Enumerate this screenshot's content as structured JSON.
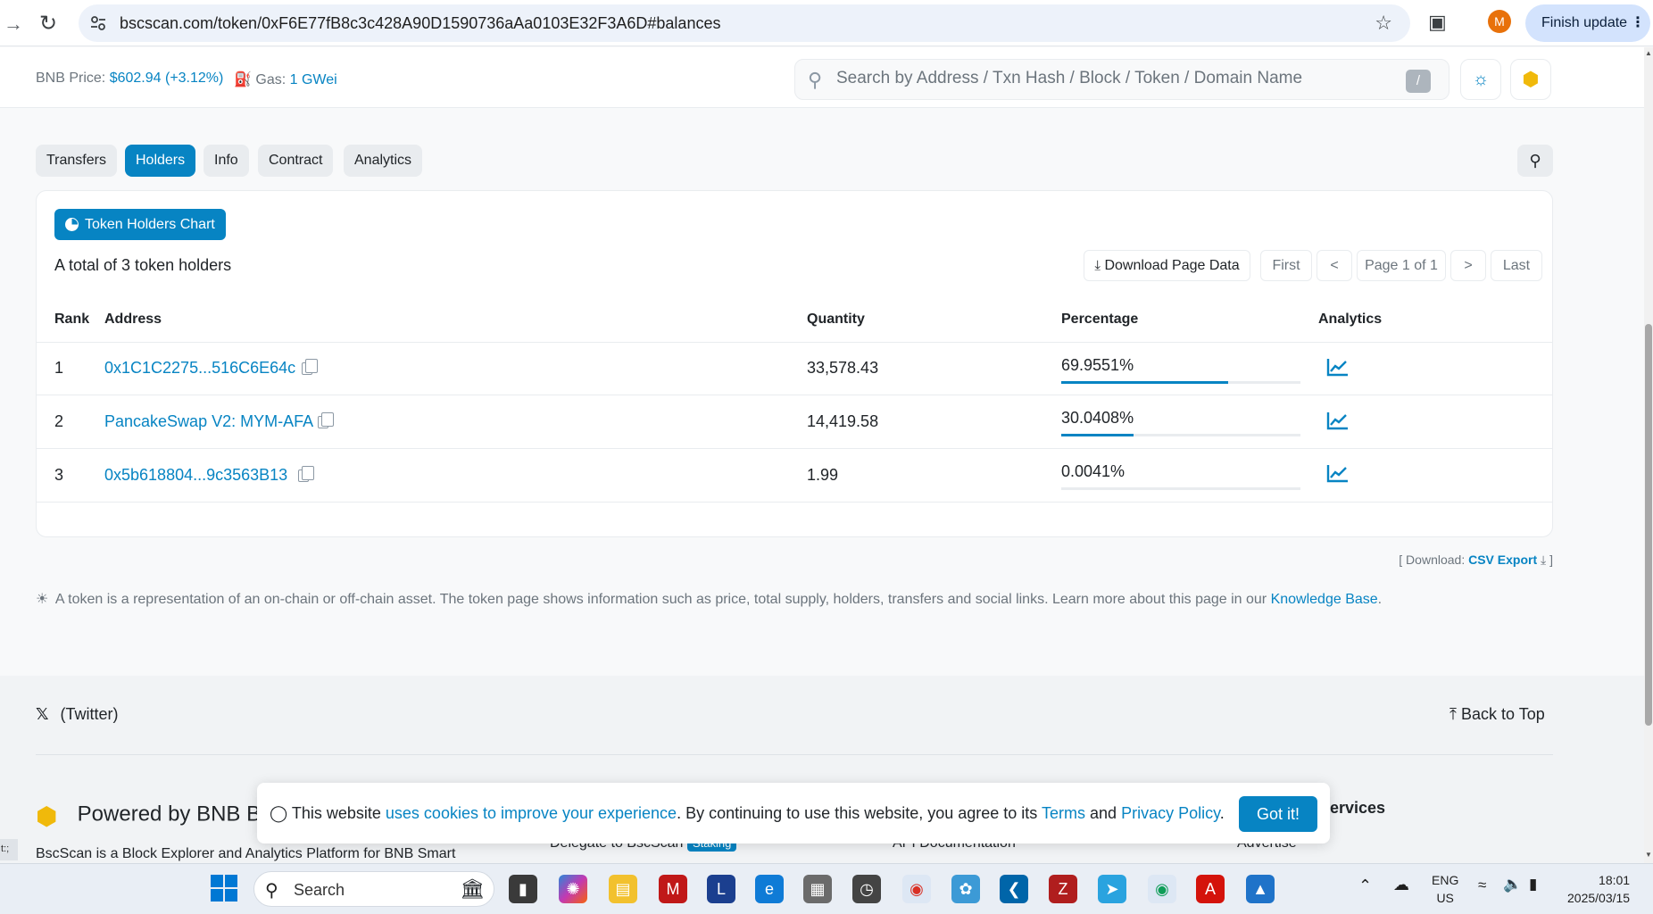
{
  "browser": {
    "url": "bscscan.com/token/0xF6E77fB8c3c428A90D1590736aAa0103E32F3A6D#balances",
    "profile_initial": "M",
    "finish_update_label": "Finish update"
  },
  "header": {
    "bnb_price_label": "BNB Price:",
    "bnb_price_value": "$602.94 (+3.12%)",
    "gas_label": "Gas:",
    "gas_value": "1 GWei",
    "search_placeholder": "Search by Address / Txn Hash / Block / Token / Domain Name",
    "search_shortcut": "/"
  },
  "tabs": [
    {
      "label": "Transfers",
      "active": false
    },
    {
      "label": "Holders",
      "active": true
    },
    {
      "label": "Info",
      "active": false
    },
    {
      "label": "Contract",
      "active": false
    },
    {
      "label": "Analytics",
      "active": false
    }
  ],
  "holders": {
    "chart_button": "Token Holders Chart",
    "total_text": "A total of 3 token holders",
    "download_page_data": "Download Page Data",
    "pager": {
      "first": "First",
      "prev": "<",
      "current": "Page 1 of 1",
      "next": ">",
      "last": "Last"
    },
    "columns": [
      "Rank",
      "Address",
      "Quantity",
      "Percentage",
      "Analytics"
    ],
    "rows": [
      {
        "rank": "1",
        "address": "0x1C1C2275...516C6E64c",
        "quantity": "33,578.43",
        "percentage": "69.9551%",
        "pct_value": 69.9551
      },
      {
        "rank": "2",
        "address": "PancakeSwap V2: MYM-AFA",
        "quantity": "14,419.58",
        "percentage": "30.0408%",
        "pct_value": 30.0408
      },
      {
        "rank": "3",
        "address": "0x5b618804...9c3563B13",
        "quantity": "1.99",
        "percentage": "0.0041%",
        "pct_value": 0.0041
      }
    ]
  },
  "download": {
    "prefix": "[ Download:",
    "link": "CSV Export",
    "suffix": "]"
  },
  "info_note": {
    "text": "A token is a representation of an on-chain or off-chain asset. The token page shows information such as price, total supply, holders, transfers and social links. Learn more about this page in our",
    "link": "Knowledge Base",
    "end": "."
  },
  "footer": {
    "twitter": "(Twitter)",
    "back_to_top": "Back to Top",
    "powered_by": "Powered by BNB Be",
    "description": "BscScan is a Block Explorer and Analytics Platform for BNB Smart",
    "delegate": "Delegate to BscScan",
    "staking_badge": "Staking",
    "api_docs": "API Documentation",
    "advertise": "Advertise",
    "services": "ervices"
  },
  "cookie": {
    "text_1": "This website",
    "link_1": "uses cookies to improve your experience",
    "text_2": ". By continuing to use this website, you agree to its",
    "link_2": "Terms",
    "text_3": "and",
    "link_3": "Privacy Policy",
    "text_4": ".",
    "button": "Got it!"
  },
  "taskbar": {
    "search_label": "Search",
    "lang_1": "ENG",
    "lang_2": "US",
    "time": "18:01",
    "date": "2025/03/15"
  },
  "left_status": "t:;",
  "colors": {
    "accent": "#0784c3",
    "bnb": "#f0b90b"
  }
}
